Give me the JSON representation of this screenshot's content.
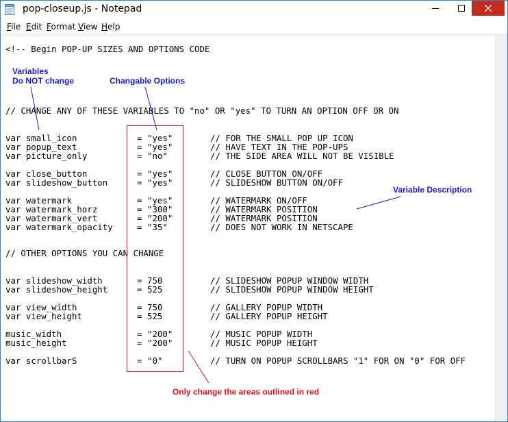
{
  "window": {
    "title": "pop-closeup.js - Notepad"
  },
  "menu": [
    "File",
    "Edit",
    "Format",
    "View",
    "Help"
  ],
  "code": {
    "comment_begin": "<!-- Begin POP-UP SIZES AND OPTIONS CODE",
    "comment_change": "// CHANGE ANY OF THESE VARIABLES TO \"no\" OR \"yes\" TO TURN AN OPTION OFF OR ON",
    "comment_other": "// OTHER OPTIONS YOU CAN CHANGE",
    "rows": [
      {
        "name": "var small_icon",
        "eq": "=",
        "value": "\"yes\"",
        "comment": "// FOR THE SMALL POP UP ICON"
      },
      {
        "name": "var popup_text",
        "eq": "=",
        "value": "\"yes\"",
        "comment": "// HAVE TEXT IN THE POP-UPS"
      },
      {
        "name": "var picture_only",
        "eq": "=",
        "value": "\"no\"",
        "comment": "// THE SIDE AREA WILL NOT BE VISIBLE"
      },
      {
        "name": "var close_button",
        "eq": "=",
        "value": "\"yes\"",
        "comment": "// CLOSE BUTTON ON/OFF"
      },
      {
        "name": "var slideshow_button",
        "eq": "=",
        "value": "\"yes\"",
        "comment": "// SLIDESHOW BUTTON ON/OFF"
      },
      {
        "name": "var watermark",
        "eq": "=",
        "value": "\"yes\"",
        "comment": "// WATERMARK ON/OFF"
      },
      {
        "name": "var watermark_horz",
        "eq": "=",
        "value": "\"300\"",
        "comment": "// WATERMARK POSITION"
      },
      {
        "name": "var watermark_vert",
        "eq": "=",
        "value": "\"200\"",
        "comment": "// WATERMARK POSITION"
      },
      {
        "name": "var watermark_opacity",
        "eq": "=",
        "value": "\"35\"",
        "comment": "// DOES NOT WORK IN NETSCAPE"
      },
      {
        "name": "var slideshow_width",
        "eq": "=",
        "value": "750",
        "comment": "// SLIDESHOW POPUP WINDOW WIDTH"
      },
      {
        "name": "var slideshow_height",
        "eq": "=",
        "value": "525",
        "comment": "// SLIDESHOW POPUP WINDOW HEIGHT"
      },
      {
        "name": "var view_width",
        "eq": "=",
        "value": "750",
        "comment": "// GALLERY POPUP WIDTH"
      },
      {
        "name": "var view_height",
        "eq": "=",
        "value": "525",
        "comment": "// GALLERY POPUP HEIGHT"
      },
      {
        "name": "music_width",
        "eq": "=",
        "value": "\"200\"",
        "comment": "// MUSIC POPUP WIDTH"
      },
      {
        "name": "music_height",
        "eq": "=",
        "value": "\"200\"",
        "comment": "// MUSIC POPUP HEIGHT"
      },
      {
        "name": "var scrollbarS",
        "eq": "=",
        "value": "\"0\"",
        "comment": "// TURN ON POPUP SCROLLBARS \"1\" FOR ON \"0\" FOR OFF"
      }
    ]
  },
  "annotations": {
    "variables_line1": "Variables",
    "variables_line2": "Do NOT change",
    "changable": "Changable Options",
    "description": "Variable Description",
    "red_note": "Only change the areas outlined in red"
  },
  "colors": {
    "annotation_blue": "#1a1acc",
    "annotation_red": "#e01010",
    "close_button": "#c42b1c",
    "window_border": "#1f8ad2"
  }
}
